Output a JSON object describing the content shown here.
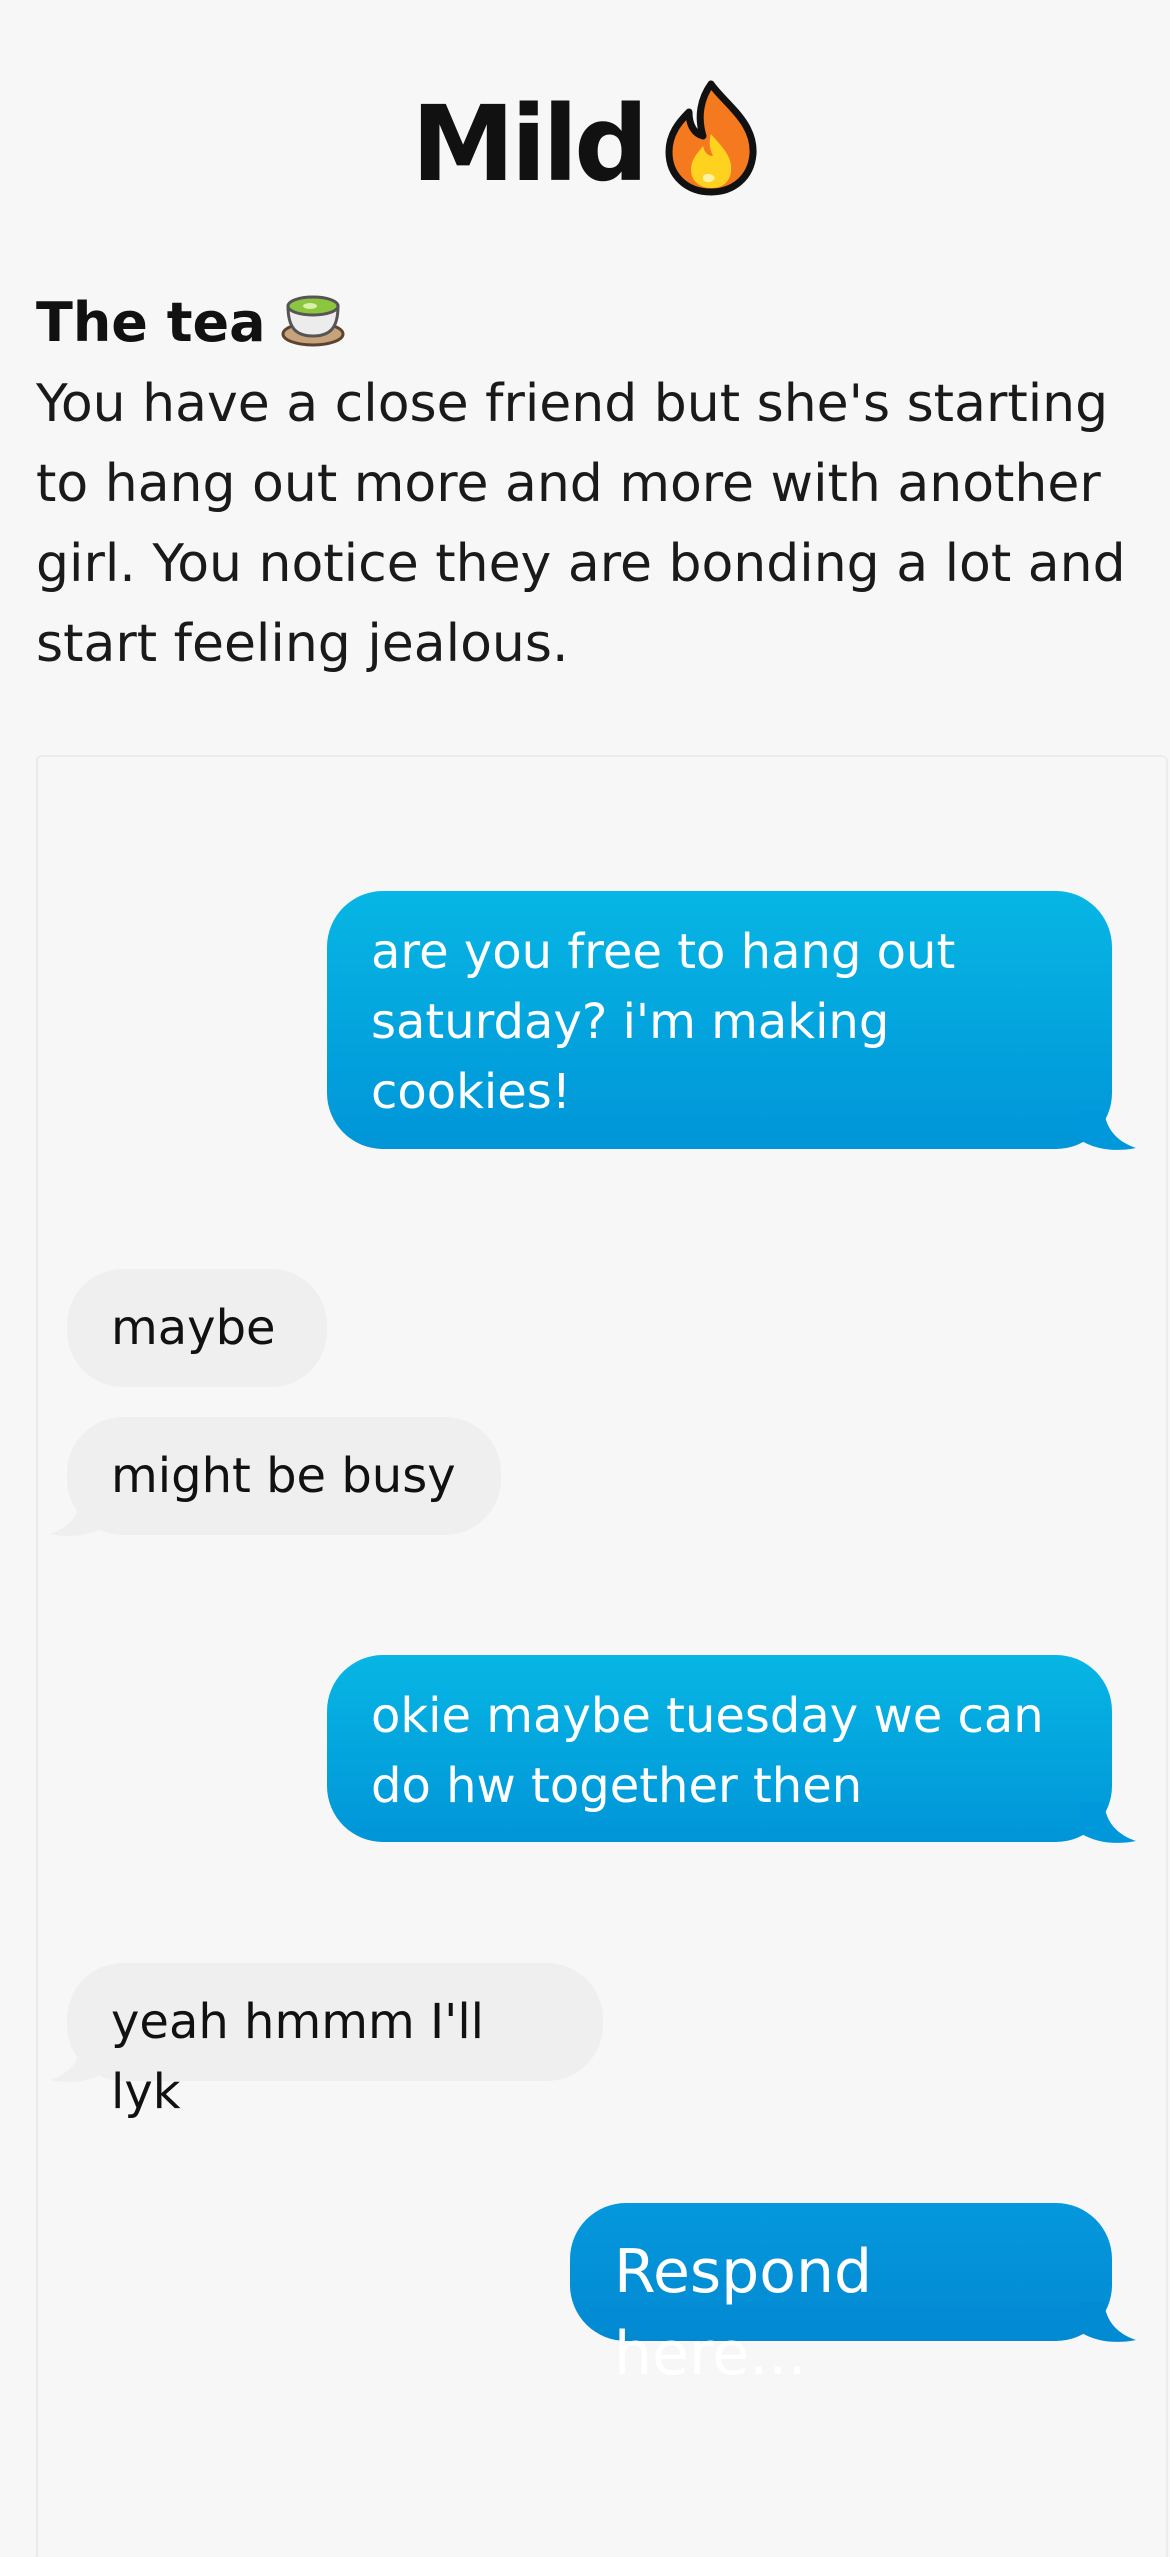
{
  "header": {
    "title": "Mild",
    "title_icon": "fire-icon"
  },
  "scenario": {
    "heading": "The tea",
    "heading_icon": "tea-cup-icon",
    "body": "You have a close friend but she's starting to hang out more and more with another girl. You notice they are bonding a lot and start feeling jealous."
  },
  "chat": {
    "messages": [
      {
        "from": "me",
        "text": "are you free to hang out saturday? i'm making cookies!"
      },
      {
        "from": "friend",
        "text": "maybe"
      },
      {
        "from": "friend",
        "text": "might be busy"
      },
      {
        "from": "me",
        "text": "okie maybe tuesday we can do hw together then"
      },
      {
        "from": "friend",
        "text": "yeah hmmm I'll lyk"
      }
    ],
    "respond_placeholder": "Respond here..."
  },
  "colors": {
    "sent_bubble_top": "#07b6e4",
    "sent_bubble_bottom": "#0095d8",
    "received_bubble": "#efefef",
    "background": "#f7f7f7"
  }
}
